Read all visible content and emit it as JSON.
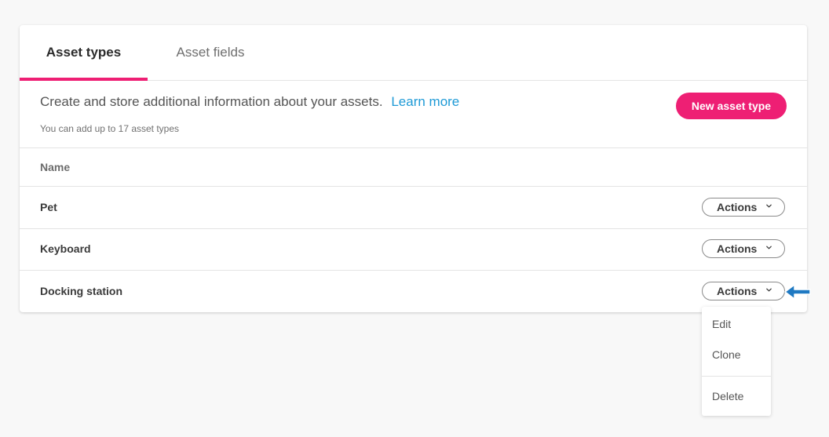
{
  "tabs": [
    {
      "label": "Asset types",
      "active": true
    },
    {
      "label": "Asset fields",
      "active": false
    }
  ],
  "intro": {
    "description": "Create and store additional information about your assets.",
    "learn_more": "Learn more",
    "limit_text": "You can add up to 17 asset types"
  },
  "new_button": "New asset type",
  "table": {
    "column_header": "Name",
    "rows": [
      {
        "name": "Pet",
        "action_label": "Actions"
      },
      {
        "name": "Keyboard",
        "action_label": "Actions"
      },
      {
        "name": "Docking station",
        "action_label": "Actions"
      }
    ]
  },
  "dropdown": {
    "items": [
      "Edit",
      "Clone",
      "Delete"
    ]
  },
  "colors": {
    "accent": "#ee1f74",
    "link": "#1e9ad6",
    "annotation_arrow": "#1f79c2"
  },
  "icons": {
    "chevron": "chevron-down-icon",
    "annotation": "arrow-left-icon"
  }
}
